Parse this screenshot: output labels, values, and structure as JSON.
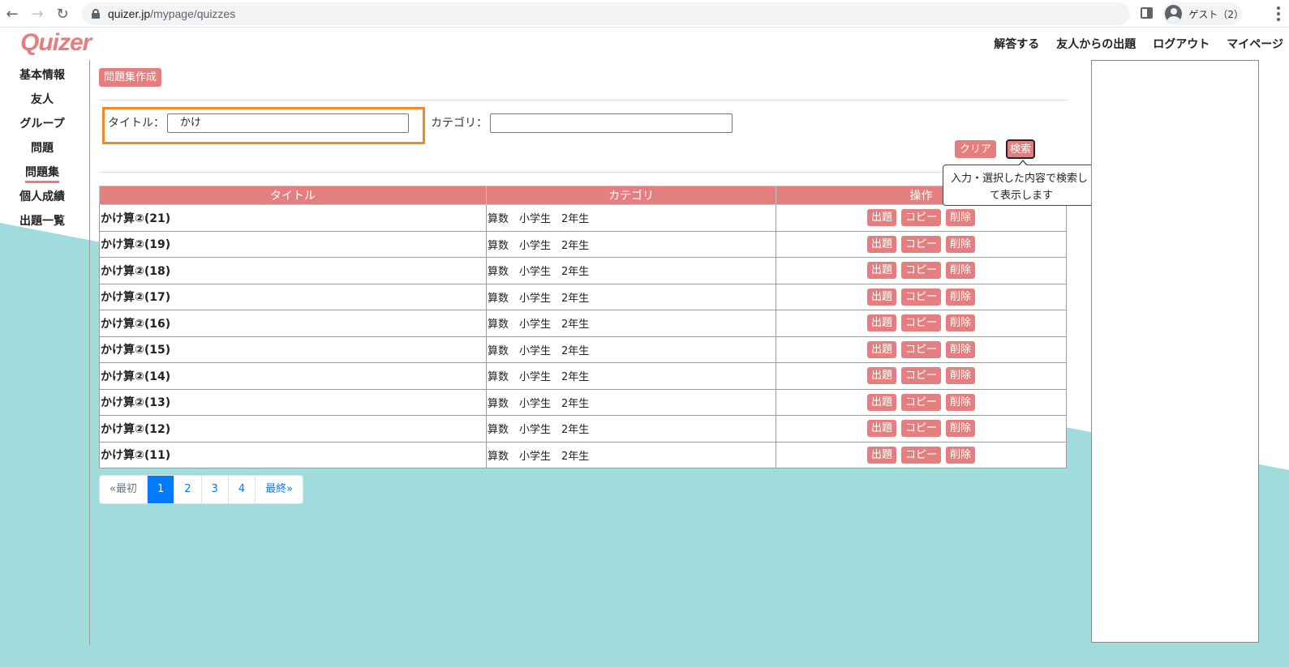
{
  "browser": {
    "url_host": "quizer.jp",
    "url_path": "/mypage/quizzes",
    "profile_label": "ゲスト（2）"
  },
  "header": {
    "logo": "Quizer",
    "nav": [
      "解答する",
      "友人からの出題",
      "ログアウト",
      "マイページ"
    ]
  },
  "sidebar": {
    "items": [
      {
        "label": "基本情報"
      },
      {
        "label": "友人"
      },
      {
        "label": "グループ"
      },
      {
        "label": "問題"
      },
      {
        "label": "問題集",
        "active": true
      },
      {
        "label": "個人成績"
      },
      {
        "label": "出題一覧"
      }
    ]
  },
  "main": {
    "create_label": "問題集作成",
    "search": {
      "title_label": "タイトル：",
      "title_value": "かけ",
      "category_label": "カテゴリ：",
      "category_value": "",
      "clear_label": "クリア",
      "search_label": "検索",
      "tooltip_line1": "入力・選択した内容で検索し",
      "tooltip_line2": "て表示します"
    },
    "table": {
      "headers": [
        "タイトル",
        "カテゴリ",
        "操作"
      ],
      "rows": [
        {
          "title": "かけ算②(21)",
          "category": "算数　小学生　2年生"
        },
        {
          "title": "かけ算②(19)",
          "category": "算数　小学生　2年生"
        },
        {
          "title": "かけ算②(18)",
          "category": "算数　小学生　2年生"
        },
        {
          "title": "かけ算②(17)",
          "category": "算数　小学生　2年生"
        },
        {
          "title": "かけ算②(16)",
          "category": "算数　小学生　2年生"
        },
        {
          "title": "かけ算②(15)",
          "category": "算数　小学生　2年生"
        },
        {
          "title": "かけ算②(14)",
          "category": "算数　小学生　2年生"
        },
        {
          "title": "かけ算②(13)",
          "category": "算数　小学生　2年生"
        },
        {
          "title": "かけ算②(12)",
          "category": "算数　小学生　2年生"
        },
        {
          "title": "かけ算②(11)",
          "category": "算数　小学生　2年生"
        }
      ],
      "actions": [
        "出題",
        "コピー",
        "削除"
      ]
    },
    "pagination": {
      "first": "«最初",
      "pages": [
        "1",
        "2",
        "3",
        "4"
      ],
      "current": "1",
      "last": "最終»"
    }
  },
  "colors": {
    "accent": "#e57e7e",
    "teal_background": "#a0dcdc",
    "highlight": "#f08a24",
    "link_blue": "#007bff"
  }
}
